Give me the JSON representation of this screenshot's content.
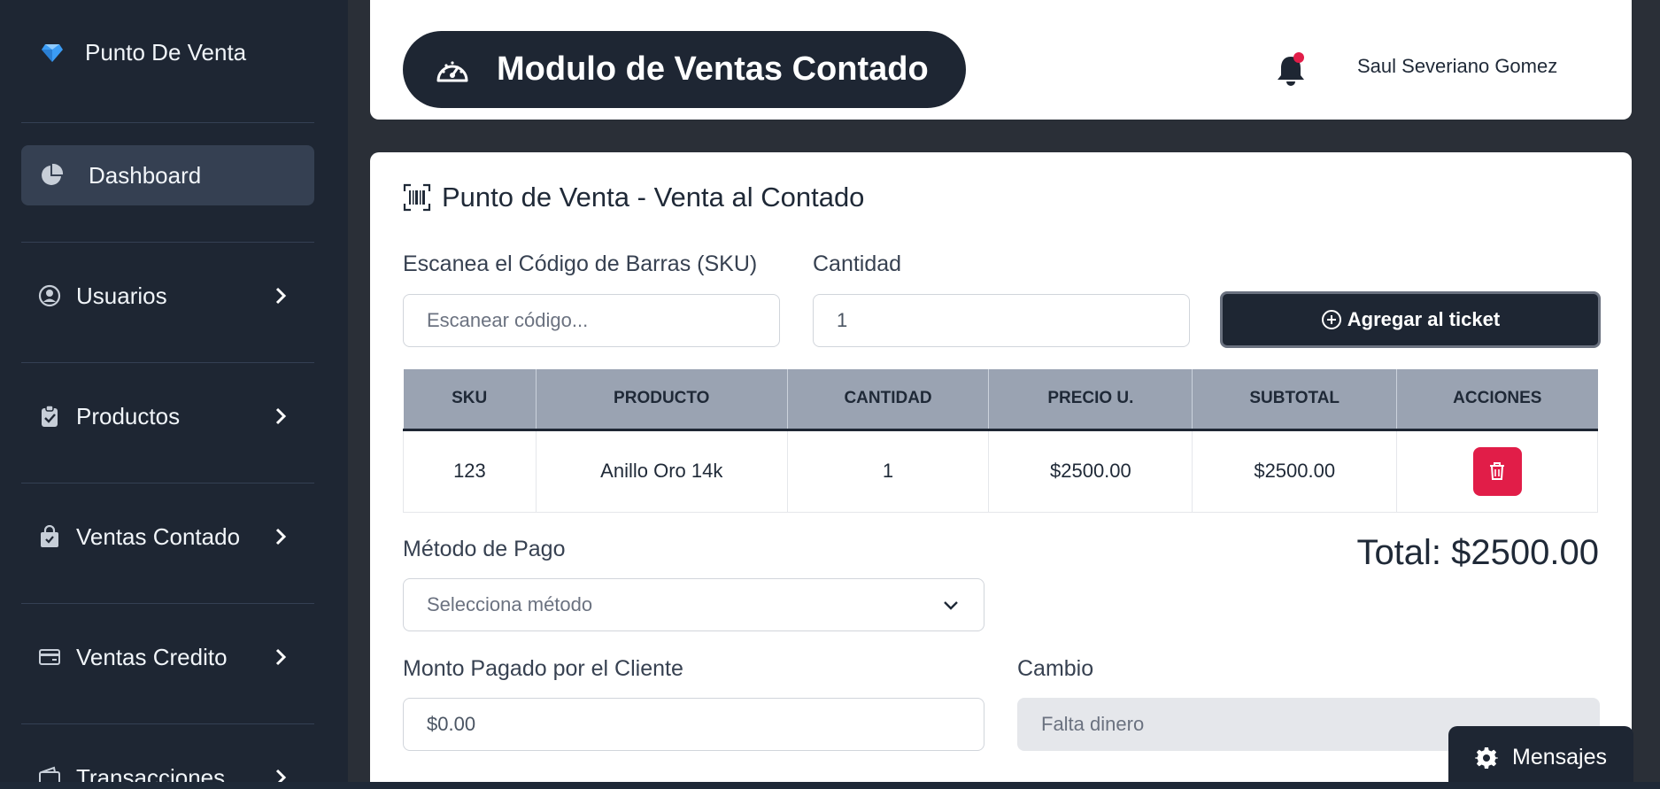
{
  "sidebar": {
    "brand": "Punto De Venta",
    "items": [
      {
        "label": "Dashboard",
        "icon": "pie-chart-icon"
      },
      {
        "label": "Usuarios",
        "icon": "user-circle-icon"
      },
      {
        "label": "Productos",
        "icon": "clipboard-check-icon"
      },
      {
        "label": "Ventas Contado",
        "icon": "shopping-bag-icon"
      },
      {
        "label": "Ventas Credito",
        "icon": "credit-card-icon"
      },
      {
        "label": "Transacciones",
        "icon": "wallet-icon"
      }
    ]
  },
  "header": {
    "title": "Modulo de Ventas Contado",
    "user": "Saul Severiano Gomez"
  },
  "pos": {
    "section_title": "Punto de Venta - Venta al Contado",
    "sku_label": "Escanea el Código de Barras (SKU)",
    "sku_placeholder": "Escanear código...",
    "qty_label": "Cantidad",
    "qty_value": "1",
    "add_button": "Agregar al ticket",
    "table": {
      "headers": [
        "SKU",
        "PRODUCTO",
        "CANTIDAD",
        "PRECIO U.",
        "SUBTOTAL",
        "ACCIONES"
      ],
      "rows": [
        {
          "sku": "123",
          "producto": "Anillo Oro 14k",
          "cantidad": "1",
          "precio": "$2500.00",
          "subtotal": "$2500.00"
        }
      ]
    },
    "payment_label": "Método de Pago",
    "payment_placeholder": "Selecciona método",
    "total": "Total: $2500.00",
    "paid_label": "Monto Pagado por el Cliente",
    "paid_value": "$0.00",
    "change_label": "Cambio",
    "change_value": "Falta dinero"
  },
  "messages_button": "Mensajes",
  "colors": {
    "sidebar_bg": "#1e2633",
    "accent_dark": "#1e2633",
    "danger": "#e11d48",
    "notification_dot": "#e11d48",
    "table_header": "#9aa3b2"
  }
}
